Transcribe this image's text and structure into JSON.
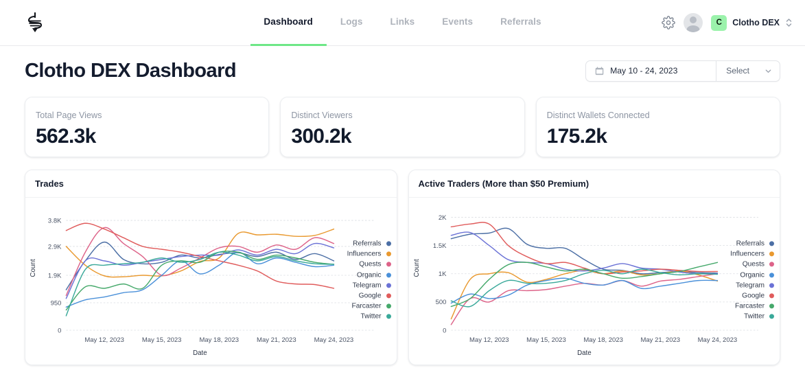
{
  "nav": {
    "logo_icon": "clotho-logo-icon",
    "items": [
      {
        "label": "Dashboard",
        "active": true
      },
      {
        "label": "Logs",
        "active": false
      },
      {
        "label": "Links",
        "active": false
      },
      {
        "label": "Events",
        "active": false
      },
      {
        "label": "Referrals",
        "active": false
      }
    ],
    "settings_icon": "gear-icon",
    "avatar_icon": "avatar",
    "account": {
      "badge": "C",
      "name": "Clotho DEX",
      "selector_icon": "up-down-chevron-icon"
    }
  },
  "header": {
    "title": "Clotho DEX Dashboard",
    "date_range": {
      "icon": "calendar-icon",
      "value": "May 10 - 24, 2023"
    },
    "select": {
      "label": "Select",
      "icon": "chevron-down-icon"
    }
  },
  "stats": [
    {
      "label": "Total Page Views",
      "value": "562.3k"
    },
    {
      "label": "Distinct Viewers",
      "value": "300.2k"
    },
    {
      "label": "Distinct Wallets Connected",
      "value": "175.2k"
    }
  ],
  "colors": {
    "accent_green": "#6ee787",
    "badge_green": "#9bf2ab",
    "title_dark": "#141c2e",
    "muted": "#8d95a3",
    "series": {
      "Referrals": "#4c6fa5",
      "Influencers": "#e9992f",
      "Quests": "#dd6389",
      "Organic": "#4a90d9",
      "Telegram": "#6b72d6",
      "Google": "#e05c5c",
      "Farcaster": "#46a96b",
      "Twitter": "#3aa99a"
    }
  },
  "chart_data": [
    {
      "type": "line",
      "title": "Trades",
      "xlabel": "Date",
      "ylabel": "Count",
      "ylim": [
        0,
        4300
      ],
      "yticks": [
        0,
        950,
        1900,
        2900,
        3800
      ],
      "ytick_labels": [
        "0",
        "950",
        "1.9K",
        "2.9K",
        "3.8K"
      ],
      "grid": true,
      "legend_position": "right",
      "x": [
        "May 10, 2023",
        "May 11, 2023",
        "May 12, 2023",
        "May 13, 2023",
        "May 14, 2023",
        "May 15, 2023",
        "May 16, 2023",
        "May 17, 2023",
        "May 18, 2023",
        "May 19, 2023",
        "May 20, 2023",
        "May 21, 2023",
        "May 22, 2023",
        "May 23, 2023",
        "May 24, 2023"
      ],
      "xtick_labels": [
        "May 12, 2023",
        "May 15, 2023",
        "May 18, 2023",
        "May 21, 2023",
        "May 24, 2023"
      ],
      "series": [
        {
          "name": "Referrals",
          "values": [
            1400,
            2400,
            3050,
            2450,
            2300,
            2350,
            2600,
            2500,
            2620,
            2680,
            2550,
            2700,
            2450,
            2650,
            2400
          ]
        },
        {
          "name": "Influencers",
          "values": [
            2900,
            2250,
            1880,
            1850,
            1900,
            1880,
            2050,
            2380,
            2500,
            3350,
            3300,
            3320,
            3250,
            3280,
            3500
          ]
        },
        {
          "name": "Quests",
          "values": [
            1200,
            2700,
            3550,
            3000,
            2550,
            1900,
            2150,
            2500,
            2850,
            2900,
            2700,
            2950,
            2800,
            3200,
            3000
          ]
        },
        {
          "name": "Organic",
          "values": [
            800,
            1050,
            1150,
            1300,
            1400,
            1900,
            2400,
            1950,
            2250,
            2700,
            2300,
            2500,
            2350,
            2200,
            2250
          ]
        },
        {
          "name": "Telegram",
          "values": [
            1100,
            2400,
            2400,
            2250,
            2350,
            2450,
            2550,
            2600,
            2600,
            2780,
            2600,
            2800,
            2650,
            3000,
            2850
          ]
        },
        {
          "name": "Google",
          "values": [
            3450,
            3700,
            3500,
            3200,
            2900,
            2800,
            2700,
            2550,
            2400,
            2250,
            2050,
            1700,
            1600,
            1580,
            1450
          ]
        },
        {
          "name": "Farcaster",
          "values": [
            700,
            1500,
            1450,
            1600,
            1450,
            2250,
            2400,
            2350,
            2700,
            2700,
            2450,
            2600,
            2500,
            2350,
            2280
          ]
        },
        {
          "name": "Twitter",
          "values": [
            500,
            2100,
            2250,
            2300,
            2350,
            2500,
            2350,
            2450,
            2700,
            2600,
            2400,
            2550,
            2400,
            2300,
            2280
          ]
        }
      ]
    },
    {
      "type": "line",
      "title": "Active Traders (More than $50 Premium)",
      "xlabel": "Date",
      "ylabel": "Count",
      "ylim": [
        0,
        2200
      ],
      "yticks": [
        0,
        500,
        1000,
        1500,
        2000
      ],
      "ytick_labels": [
        "0",
        "500",
        "1K",
        "1.5K",
        "2K"
      ],
      "grid": true,
      "legend_position": "right",
      "x": [
        "May 10, 2023",
        "May 11, 2023",
        "May 12, 2023",
        "May 13, 2023",
        "May 14, 2023",
        "May 15, 2023",
        "May 16, 2023",
        "May 17, 2023",
        "May 18, 2023",
        "May 19, 2023",
        "May 20, 2023",
        "May 21, 2023",
        "May 22, 2023",
        "May 23, 2023",
        "May 24, 2023"
      ],
      "xtick_labels": [
        "May 12, 2023",
        "May 15, 2023",
        "May 18, 2023",
        "May 21, 2023",
        "May 24, 2023"
      ],
      "series": [
        {
          "name": "Referrals",
          "values": [
            1620,
            1700,
            1720,
            1800,
            1520,
            1450,
            1450,
            1250,
            1080,
            1060,
            1000,
            1020,
            1040,
            1020,
            1010
          ]
        },
        {
          "name": "Influencers",
          "values": [
            200,
            900,
            1000,
            1020,
            850,
            900,
            1000,
            1060,
            1000,
            1050,
            980,
            1000,
            1050,
            980,
            870
          ]
        },
        {
          "name": "Quests",
          "values": [
            100,
            560,
            500,
            700,
            700,
            720,
            780,
            830,
            800,
            880,
            780,
            870,
            900,
            950,
            1000
          ]
        },
        {
          "name": "Organic",
          "values": [
            480,
            640,
            560,
            620,
            800,
            880,
            920,
            830,
            800,
            880,
            740,
            780,
            830,
            880,
            880
          ]
        },
        {
          "name": "Telegram",
          "values": [
            1680,
            1730,
            1500,
            1250,
            1200,
            1180,
            1080,
            1050,
            1100,
            1180,
            1100,
            1080,
            1030,
            1000,
            1000
          ]
        },
        {
          "name": "Google",
          "values": [
            1830,
            1880,
            1880,
            1500,
            1300,
            1180,
            1200,
            1100,
            1000,
            1030,
            1050,
            1080,
            1060,
            1040,
            1040
          ]
        },
        {
          "name": "Farcaster",
          "values": [
            420,
            560,
            900,
            1160,
            1200,
            1120,
            1050,
            1080,
            1000,
            920,
            950,
            1000,
            1040,
            1120,
            1200
          ]
        },
        {
          "name": "Twitter",
          "values": [
            520,
            420,
            700,
            880,
            830,
            830,
            880,
            1000,
            1060,
            1000,
            1080,
            1020,
            980,
            1000,
            990
          ]
        }
      ]
    }
  ]
}
